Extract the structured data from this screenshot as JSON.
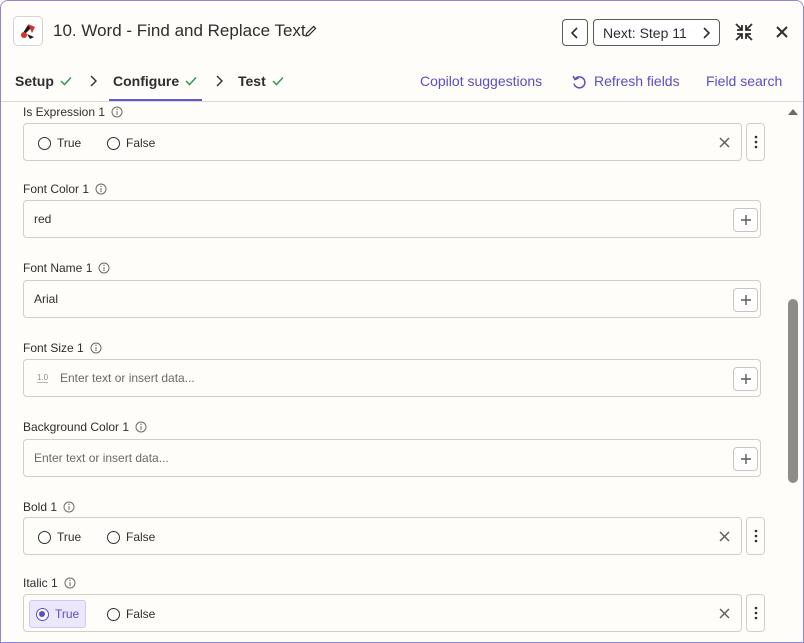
{
  "header": {
    "title": "10. Word - Find and Replace Text",
    "next_label": "Next: Step 11"
  },
  "tabs": [
    {
      "label": "Setup"
    },
    {
      "label": "Configure"
    },
    {
      "label": "Test"
    }
  ],
  "links": {
    "copilot": "Copilot suggestions",
    "refresh": "Refresh fields",
    "field_search": "Field search"
  },
  "fields": {
    "is_expression": {
      "label": "Is Expression 1",
      "true_label": "True",
      "false_label": "False",
      "selected": null
    },
    "font_color": {
      "label": "Font Color 1",
      "value": "red"
    },
    "font_name": {
      "label": "Font Name 1",
      "value": "Arial"
    },
    "font_size": {
      "label": "Font Size 1",
      "badge": "1.0",
      "placeholder": "Enter text or insert data..."
    },
    "background_color": {
      "label": "Background Color 1",
      "placeholder": "Enter text or insert data..."
    },
    "bold": {
      "label": "Bold 1",
      "true_label": "True",
      "false_label": "False",
      "selected": null
    },
    "italic": {
      "label": "Italic 1",
      "true_label": "True",
      "false_label": "False",
      "selected": "True"
    }
  },
  "colors": {
    "accent": "#6457d6",
    "check": "#2e9b4e",
    "border": "#d2cfc8"
  }
}
